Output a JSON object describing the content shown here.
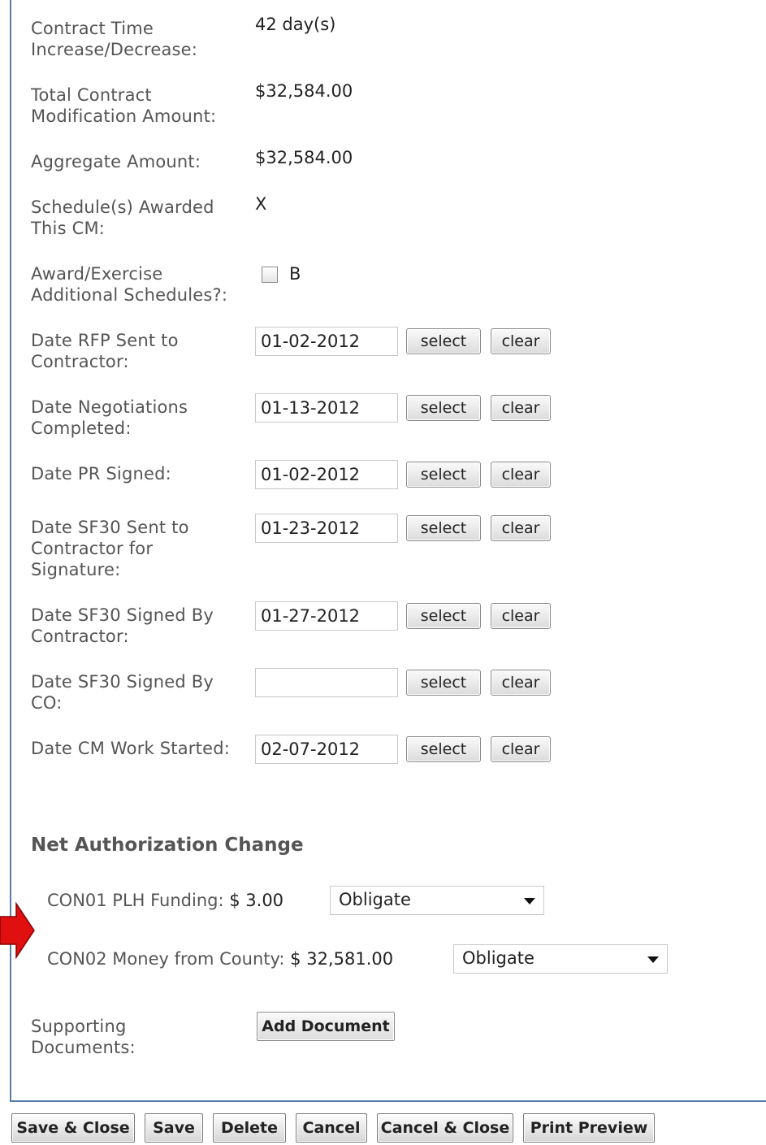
{
  "fields": {
    "contract_time": {
      "label_1": "Contract Time",
      "label_2": "Increase/Decrease:",
      "value": "42 day(s)"
    },
    "total_mod": {
      "label_1": "Total Contract",
      "label_2": "Modification Amount:",
      "value": "$32,584.00"
    },
    "aggregate": {
      "label_1": "Aggregate Amount:",
      "value": "$32,584.00"
    },
    "schedules_awarded": {
      "label_1": "Schedule(s) Awarded",
      "label_2": "This CM:",
      "value": "X"
    },
    "award_exercise": {
      "label_1": "Award/Exercise",
      "label_2": "Additional Schedules?:",
      "checkbox_label": "B",
      "checked": false
    }
  },
  "dates": {
    "rfp_sent": {
      "label_1": "Date RFP Sent to",
      "label_2": "Contractor:",
      "value": "01-02-2012"
    },
    "negotiations": {
      "label_1": "Date Negotiations",
      "label_2": "Completed:",
      "value": "01-13-2012"
    },
    "pr_signed": {
      "label_1": "Date PR Signed:",
      "value": "01-02-2012"
    },
    "sf30_sent": {
      "label_1": "Date SF30 Sent to",
      "label_2": "Contractor for",
      "label_3": "Signature:",
      "value": "01-23-2012"
    },
    "sf30_contractor": {
      "label_1": "Date SF30 Signed By",
      "label_2": "Contractor:",
      "value": "01-27-2012"
    },
    "sf30_co": {
      "label_1": "Date SF30 Signed By",
      "label_2": "CO:",
      "value": ""
    },
    "cm_started": {
      "label_1": "Date CM Work Started:",
      "value": "02-07-2012"
    }
  },
  "buttons": {
    "select": "select",
    "clear": "clear"
  },
  "net_auth": {
    "title": "Net Authorization Change",
    "rows": [
      {
        "label": "CON01 PLH Funding:",
        "amount": "$ 3.00",
        "action": "Obligate"
      },
      {
        "label": "CON02 Money from County:",
        "amount": "$ 32,581.00",
        "action": "Obligate"
      }
    ]
  },
  "supporting": {
    "label_1": "Supporting",
    "label_2": "Documents:",
    "button": "Add Document"
  },
  "footer": {
    "save_close": "Save & Close",
    "save": "Save",
    "delete": "Delete",
    "cancel": "Cancel",
    "cancel_close": "Cancel & Close",
    "print_preview": "Print Preview"
  },
  "colors": {
    "frame": "#5a7aa8",
    "arrow": "#e01010"
  }
}
